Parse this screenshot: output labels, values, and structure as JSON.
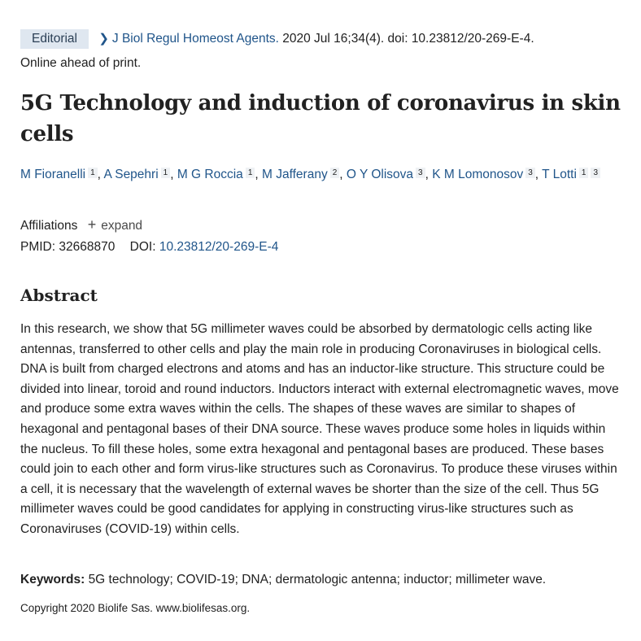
{
  "citation": {
    "badge": "Editorial",
    "journal": "J Biol Regul Homeost Agents.",
    "details": "2020 Jul 16;34(4). doi: 10.23812/20-269-E-4.",
    "status": "Online ahead of print."
  },
  "title": "5G Technology and induction of coronavirus in skin cells",
  "authors": [
    {
      "name": "M Fioranelli",
      "affs": [
        "1"
      ]
    },
    {
      "name": "A Sepehri",
      "affs": [
        "1"
      ]
    },
    {
      "name": "M G Roccia",
      "affs": [
        "1"
      ]
    },
    {
      "name": "M Jafferany",
      "affs": [
        "2"
      ]
    },
    {
      "name": "O Y Olisova",
      "affs": [
        "3"
      ]
    },
    {
      "name": "K M Lomonosov",
      "affs": [
        "3"
      ]
    },
    {
      "name": "T Lotti",
      "affs": [
        "1",
        "3"
      ]
    }
  ],
  "affiliations": {
    "label": "Affiliations",
    "expand_label": "expand",
    "expand_icon": "plus-icon"
  },
  "ids": {
    "pmid_label": "PMID:",
    "pmid": "32668870",
    "doi_label": "DOI:",
    "doi": "10.23812/20-269-E-4"
  },
  "abstract": {
    "heading": "Abstract",
    "text": "In this research, we show that 5G millimeter waves could be absorbed by dermatologic cells acting like antennas, transferred to other cells and play the main role in producing Coronaviruses in biological cells. DNA is built from charged electrons and atoms and has an inductor-like structure. This structure could be divided into linear, toroid and round inductors. Inductors interact with external electromagnetic waves, move and produce some extra waves within the cells. The shapes of these waves are similar to shapes of hexagonal and pentagonal bases of their DNA source. These waves produce some holes in liquids within the nucleus. To fill these holes, some extra hexagonal and pentagonal bases are produced. These bases could join to each other and form virus-like structures such as Coronavirus. To produce these viruses within a cell, it is necessary that the wavelength of external waves be shorter than the size of the cell. Thus 5G millimeter waves could be good candidates for applying in constructing virus-like structures such as Coronaviruses (COVID-19) within cells."
  },
  "keywords": {
    "label": "Keywords:",
    "text": "5G technology; COVID-19; DNA; dermatologic antenna; inductor; millimeter wave."
  },
  "copyright": "Copyright 2020 Biolife Sas. www.biolifesas.org.",
  "colors": {
    "link": "#20558a",
    "badge_bg": "#dfe7f0",
    "text": "#212121"
  }
}
